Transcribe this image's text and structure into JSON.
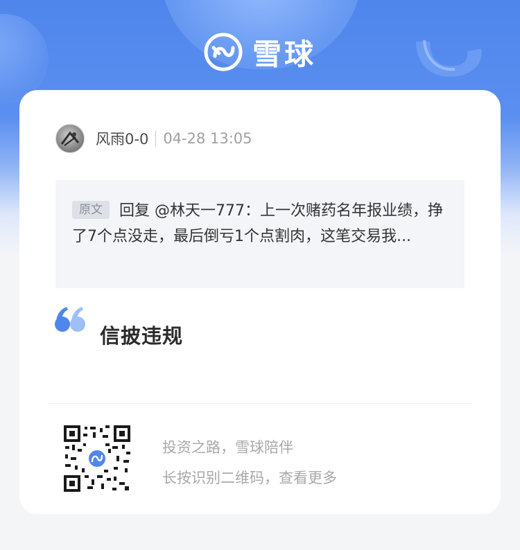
{
  "brand": {
    "name": "雪球",
    "logo_icon": "xueqiu-logo-icon",
    "accent_color": "#4f86ec"
  },
  "post": {
    "author": "风雨0-0",
    "timestamp": "04-28 13:05",
    "avatar_icon": "avatar-image",
    "quoted": {
      "tag": "原文",
      "text": "回复 @林天一777：上一次赌药名年报业绩，挣了7个点没走，最后倒亏1个点割肉，这笔交易我..."
    },
    "comment_icon": "quote-mark-icon",
    "comment": "信披违规"
  },
  "footer": {
    "qr_icon": "qr-code-icon",
    "slogan": "投资之路，雪球陪伴",
    "hint": "长按识别二维码，查看更多"
  }
}
